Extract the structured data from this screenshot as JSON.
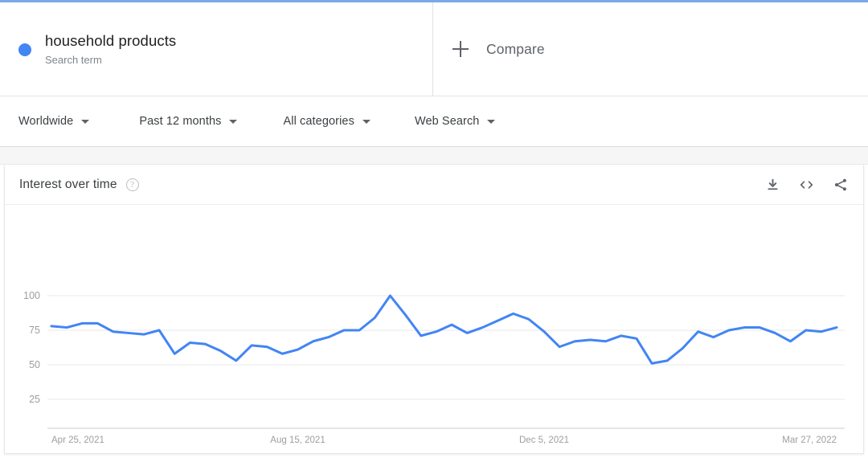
{
  "top_accent_color": "#7ba7ea",
  "search_term": {
    "dot_color": "#4285f4",
    "title": "household products",
    "subtitle": "Search term"
  },
  "compare": {
    "label": "Compare",
    "icon": "plus-icon"
  },
  "filters": [
    {
      "label": "Worldwide",
      "icon": "chevron-down-icon"
    },
    {
      "label": "Past 12 months",
      "icon": "chevron-down-icon"
    },
    {
      "label": "All categories",
      "icon": "chevron-down-icon"
    },
    {
      "label": "Web Search",
      "icon": "chevron-down-icon"
    }
  ],
  "card": {
    "title": "Interest over time",
    "help_icon": "help-circle-icon",
    "help_glyph": "?",
    "actions": [
      {
        "name": "download-icon",
        "label": "Download"
      },
      {
        "name": "embed-code-icon",
        "label": "Embed"
      },
      {
        "name": "share-icon",
        "label": "Share"
      }
    ]
  },
  "chart_data": {
    "type": "line",
    "title": "Interest over time",
    "xlabel": "",
    "ylabel": "",
    "ylim": [
      0,
      100
    ],
    "yticks": [
      25,
      50,
      75,
      100
    ],
    "ytick_labels": [
      "25",
      "50",
      "75",
      "100"
    ],
    "grid": true,
    "legend_position": "none",
    "line_color": "#4285f4",
    "line_width": 3,
    "xtick_labels": [
      "Apr 25, 2021",
      "Aug 15, 2021",
      "Dec 5, 2021",
      "Mar 27, 2022"
    ],
    "xtick_indices": [
      0,
      16,
      32,
      48
    ],
    "x": [
      "Apr 25, 2021",
      "May 2, 2021",
      "May 9, 2021",
      "May 16, 2021",
      "May 23, 2021",
      "May 30, 2021",
      "Jun 6, 2021",
      "Jun 13, 2021",
      "Jun 20, 2021",
      "Jun 27, 2021",
      "Jul 4, 2021",
      "Jul 11, 2021",
      "Jul 18, 2021",
      "Jul 25, 2021",
      "Aug 1, 2021",
      "Aug 8, 2021",
      "Aug 15, 2021",
      "Aug 22, 2021",
      "Aug 29, 2021",
      "Sep 5, 2021",
      "Sep 12, 2021",
      "Sep 19, 2021",
      "Sep 26, 2021",
      "Oct 3, 2021",
      "Oct 10, 2021",
      "Oct 17, 2021",
      "Oct 24, 2021",
      "Oct 31, 2021",
      "Nov 7, 2021",
      "Nov 14, 2021",
      "Nov 21, 2021",
      "Nov 28, 2021",
      "Dec 5, 2021",
      "Dec 12, 2021",
      "Dec 19, 2021",
      "Dec 26, 2021",
      "Jan 2, 2022",
      "Jan 9, 2022",
      "Jan 16, 2022",
      "Jan 23, 2022",
      "Jan 30, 2022",
      "Feb 6, 2022",
      "Feb 13, 2022",
      "Feb 20, 2022",
      "Feb 27, 2022",
      "Mar 6, 2022",
      "Mar 13, 2022",
      "Mar 20, 2022",
      "Mar 27, 2022",
      "Apr 3, 2022",
      "Apr 10, 2022",
      "Apr 17, 2022"
    ],
    "series": [
      {
        "name": "household products",
        "color": "#4285f4",
        "values": [
          78,
          77,
          80,
          80,
          74,
          73,
          72,
          75,
          58,
          66,
          65,
          60,
          53,
          64,
          63,
          58,
          61,
          67,
          70,
          75,
          75,
          84,
          100,
          86,
          71,
          74,
          79,
          73,
          77,
          82,
          87,
          83,
          74,
          63,
          67,
          68,
          67,
          71,
          69,
          51,
          53,
          62,
          74,
          70,
          75,
          77,
          77,
          73,
          67,
          75,
          74,
          77
        ]
      }
    ]
  }
}
